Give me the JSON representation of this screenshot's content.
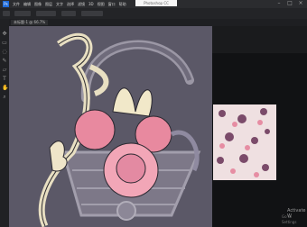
{
  "app": {
    "logo_text": "Ps",
    "title_flag": "Photoshop CC"
  },
  "menubar": {
    "items": [
      "文件",
      "编辑",
      "图像",
      "图层",
      "文字",
      "选择",
      "滤镜",
      "3D",
      "视图",
      "窗口",
      "帮助"
    ]
  },
  "document": {
    "tab_title": "未标题-1 @ 66.7%"
  },
  "watermark": {
    "line1": "Activate W",
    "line2": "Go to Settings"
  },
  "colors": {
    "canvas_bg": "#5b5867",
    "ui_dark": "#1b1c1f",
    "accent": "#1f6bd9"
  }
}
